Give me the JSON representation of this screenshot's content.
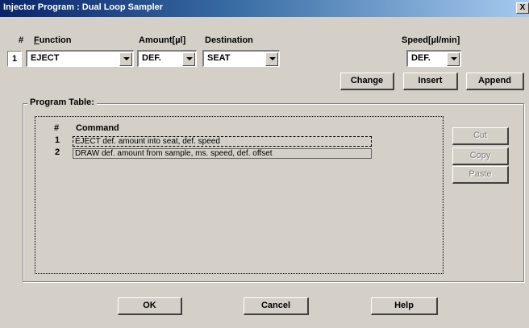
{
  "window": {
    "title": "Injector Program : Dual Loop Sampler",
    "close_label": "X"
  },
  "headers": {
    "number": "#",
    "function_first": "F",
    "function_rest": "unction",
    "amount": "Amount[µl]",
    "destination": "Destination",
    "speed": "Speed[µl/min]"
  },
  "form": {
    "row_number": "1",
    "function_value": "EJECT",
    "amount_value": "DEF.",
    "destination_value": "SEAT",
    "speed_value": "DEF."
  },
  "actions": {
    "change": "Change",
    "insert": "Insert",
    "append": "Append"
  },
  "program_table": {
    "label": "Program Table:",
    "col_number": "#",
    "col_command": "Command",
    "rows": [
      {
        "num": "1",
        "command": "EJECT def. amount into seat, def. speed"
      },
      {
        "num": "2",
        "command": "DRAW def. amount from sample, ms. speed, def. offset"
      }
    ]
  },
  "edit_buttons": {
    "cut": "Cut",
    "copy": "Copy",
    "paste": "Paste"
  },
  "footer": {
    "ok": "OK",
    "cancel": "Cancel",
    "help": "Help"
  }
}
